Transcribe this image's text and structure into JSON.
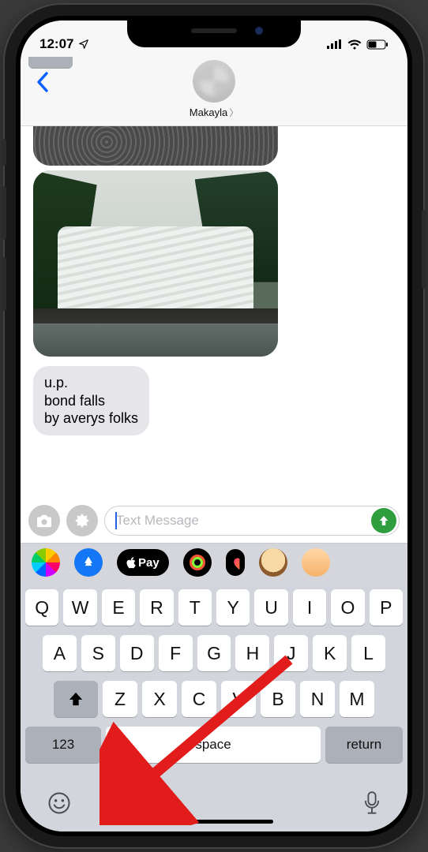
{
  "status": {
    "time": "12:07"
  },
  "header": {
    "contact_name": "Makayla"
  },
  "messages": {
    "incoming_text": "u.p.\nbond falls\nby averys folks"
  },
  "compose": {
    "placeholder": "Text Message",
    "value": ""
  },
  "app_strip": {
    "apple_pay_label": "Pay"
  },
  "keyboard": {
    "row1": [
      "Q",
      "W",
      "E",
      "R",
      "T",
      "Y",
      "U",
      "I",
      "O",
      "P"
    ],
    "row2": [
      "A",
      "S",
      "D",
      "F",
      "G",
      "H",
      "J",
      "K",
      "L"
    ],
    "row3": [
      "Z",
      "X",
      "C",
      "V",
      "B",
      "N",
      "M"
    ],
    "num_label": "123",
    "space_label": "space",
    "return_label": "return"
  }
}
